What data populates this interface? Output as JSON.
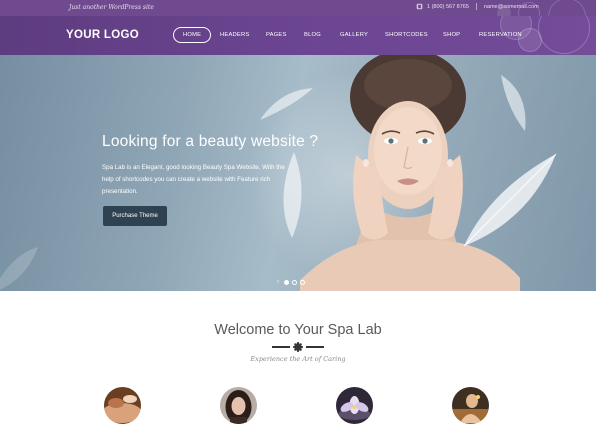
{
  "topbar": {
    "tagline": "Just another WordPress site",
    "phone": "1 (800) 567 8765",
    "email": "name@somemail.com"
  },
  "header": {
    "logo": "YOUR LOGO",
    "nav": [
      {
        "label": "HOME",
        "active": true
      },
      {
        "label": "HEADERS"
      },
      {
        "label": "PAGES"
      },
      {
        "label": "BLOG"
      },
      {
        "label": "GALLERY"
      },
      {
        "label": "SHORTCODES"
      },
      {
        "label": "SHOP"
      },
      {
        "label": "RESERVATION"
      }
    ]
  },
  "hero": {
    "title": "Looking for a beauty website ?",
    "text": "Spa Lab is an Elegant, good looking Beauty Spa Website. With the help of shortcodes you can create a website with Feature rich presentation.",
    "button": "Purchase Theme",
    "slides_total": 3,
    "slide_active": 1
  },
  "welcome": {
    "title": "Welcome to Your Spa Lab",
    "subtitle": "Experience the Art of Caring"
  },
  "colors": {
    "topbar": "#6f4a8e",
    "header": "#6b4592",
    "button": "#2f4252",
    "accent_dark": "#333333"
  },
  "icons": [
    "phone-icon",
    "flower-ornament-icon",
    "slider-arrow-icon"
  ]
}
